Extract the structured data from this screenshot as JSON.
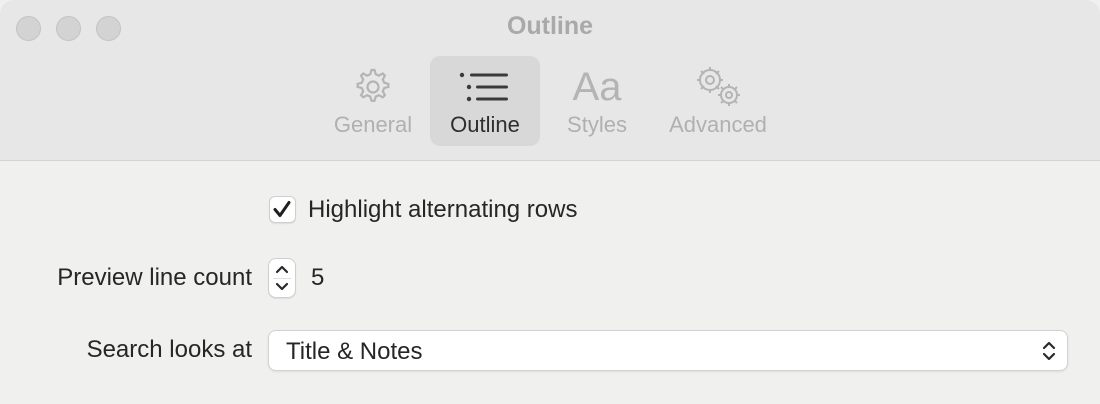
{
  "window": {
    "title": "Outline"
  },
  "tabs": [
    {
      "label": "General",
      "icon": "gear-icon",
      "active": false
    },
    {
      "label": "Outline",
      "icon": "list-icon",
      "active": true
    },
    {
      "label": "Styles",
      "icon": "text-style-icon",
      "glyph": "Aa",
      "active": false
    },
    {
      "label": "Advanced",
      "icon": "gears-icon",
      "active": false
    }
  ],
  "settings": {
    "highlight_rows": {
      "label": "Highlight alternating rows",
      "checked": true
    },
    "preview_lines": {
      "label": "Preview line count",
      "value": "5"
    },
    "search": {
      "label": "Search looks at",
      "selected": "Title & Notes"
    }
  }
}
